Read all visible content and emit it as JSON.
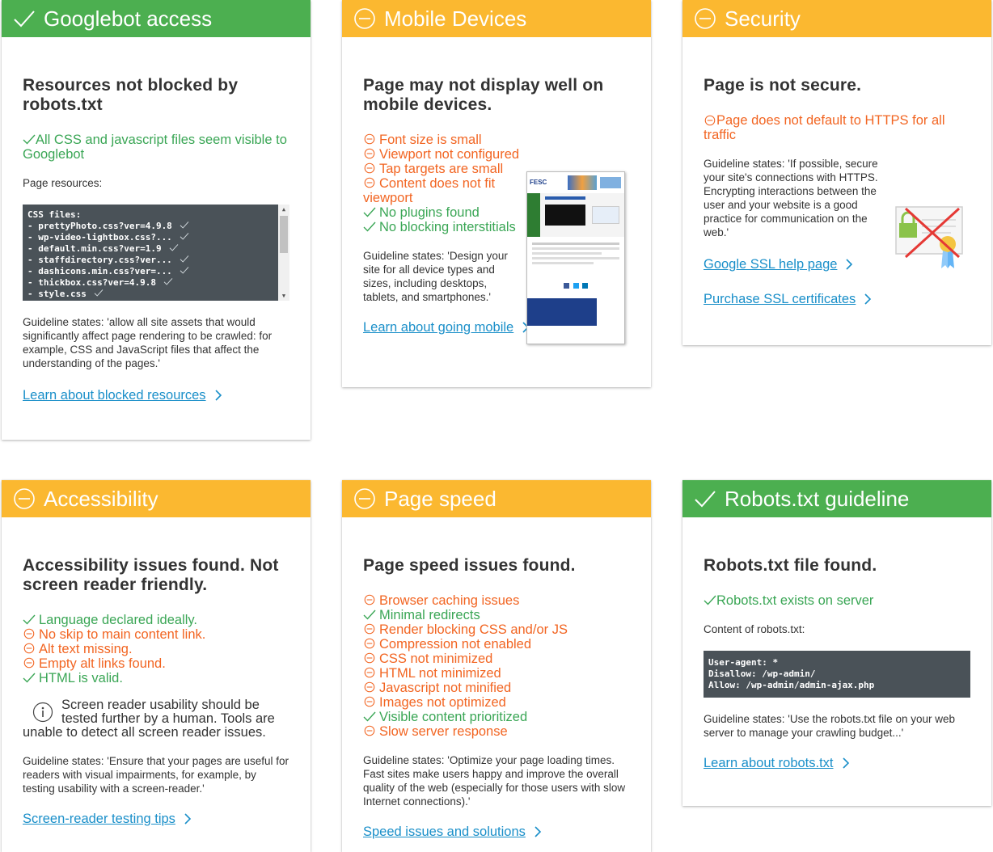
{
  "colors": {
    "green": "#4caf50",
    "orange": "#fbb830",
    "ok": "#3aa655",
    "bad": "#f26522",
    "link": "#1a8fc9"
  },
  "googlebot": {
    "title": "Googlebot access",
    "heading": "Resources not blocked by robots.txt",
    "status": "All CSS and javascript files seem visible to Googlebot",
    "resources_label": "Page resources:",
    "code_title": "CSS files:",
    "files": [
      "- prettyPhoto.css?ver=4.9.8",
      "- wp-video-lightbox.css?...",
      "- default.min.css?ver=1.9",
      "- staffdirectory.css?ver...",
      "- dashicons.min.css?ver=...",
      "- thickbox.css?ver=4.9.8",
      "- style.css"
    ],
    "guideline": "Guideline states: 'allow all site assets that would significantly affect page rendering to be crawled: for example, CSS and JavaScript files that affect the understanding of the pages.'",
    "link": "Learn about blocked resources"
  },
  "mobile": {
    "title": "Mobile Devices",
    "heading": "Page may not display well on mobile devices.",
    "items": [
      {
        "text": "Font size is small",
        "ok": false
      },
      {
        "text": "Viewport not configured",
        "ok": false
      },
      {
        "text": "Tap targets are small",
        "ok": false
      },
      {
        "text": "Content does not fit viewport",
        "ok": false
      },
      {
        "text": "No plugins found",
        "ok": true
      },
      {
        "text": "No blocking interstitials",
        "ok": true
      }
    ],
    "guideline": "Guideline states: 'Design your site for all device types and sizes, including desktops, tablets, and smartphones.'",
    "link": "Learn about going mobile",
    "preview_logo": "FESC"
  },
  "security": {
    "title": "Security",
    "heading": "Page is not secure.",
    "status": "Page does not default to HTTPS for all traffic",
    "guideline": "Guideline states: 'If possible, secure your site's connections with HTTPS. Encrypting interactions between the user and your website is a good practice for communication on the web.'",
    "link1": "Google SSL help page",
    "link2": "Purchase SSL certificates"
  },
  "accessibility": {
    "title": "Accessibility",
    "heading": "Accessibility issues found. Not screen reader friendly.",
    "items": [
      {
        "text": "Language declared ideally.",
        "ok": true
      },
      {
        "text": "No skip to main content link.",
        "ok": false
      },
      {
        "text": "Alt text missing.",
        "ok": false
      },
      {
        "text": "Empty alt links found.",
        "ok": false
      },
      {
        "text": "HTML is valid.",
        "ok": true
      }
    ],
    "note": "Screen reader usability should be tested further by a human. Tools are unable to detect all screen reader issues.",
    "guideline": "Guideline states: 'Ensure that your pages are useful for readers with visual impairments, for example, by testing usability with a screen-reader.'",
    "link": "Screen-reader testing tips"
  },
  "pagespeed": {
    "title": "Page speed",
    "heading": "Page speed issues found.",
    "items": [
      {
        "text": "Browser caching issues",
        "ok": false
      },
      {
        "text": "Minimal redirects",
        "ok": true
      },
      {
        "text": "Render blocking CSS and/or JS",
        "ok": false
      },
      {
        "text": "Compression not enabled",
        "ok": false
      },
      {
        "text": "CSS not minimized",
        "ok": false
      },
      {
        "text": "HTML not minimized",
        "ok": false
      },
      {
        "text": "Javascript not minified",
        "ok": false
      },
      {
        "text": "Images not optimized",
        "ok": false
      },
      {
        "text": "Visible content prioritized",
        "ok": true
      },
      {
        "text": "Slow server response",
        "ok": false
      }
    ],
    "guideline": "Guideline states: 'Optimize your page loading times. Fast sites make users happy and improve the overall quality of the web (especially for those users with slow Internet connections).'",
    "link": "Speed issues and solutions"
  },
  "robots": {
    "title": "Robots.txt guideline",
    "heading": "Robots.txt file found.",
    "status": "Robots.txt exists on server",
    "content_label": "Content of robots.txt:",
    "lines": [
      "User-agent: *",
      "Disallow: /wp-admin/",
      "Allow: /wp-admin/admin-ajax.php"
    ],
    "guideline": "Guideline states: 'Use the robots.txt file on your web server to manage your crawling budget...'",
    "link": "Learn about robots.txt"
  }
}
